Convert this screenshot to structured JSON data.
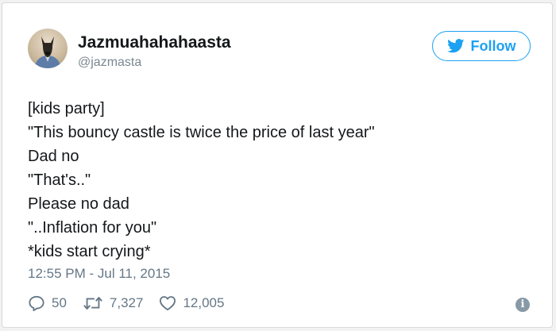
{
  "user": {
    "display_name": "Jazmuahahahaasta",
    "handle": "@jazmasta"
  },
  "follow_button": {
    "label": "Follow",
    "icon": "bird-icon"
  },
  "tweet": {
    "lines": [
      "[kids party]",
      "\"This bouncy castle is twice the price of last year\"",
      "Dad no",
      "\"That's..\"",
      "Please no dad",
      "\"..Inflation for you\"",
      "*kids start crying*"
    ],
    "timestamp": "12:55 PM - Jul 11, 2015"
  },
  "stats": {
    "replies": "50",
    "retweets": "7,327",
    "likes": "12,005"
  },
  "colors": {
    "accent": "#1da1f2",
    "text": "#14171a",
    "muted": "#657786"
  }
}
